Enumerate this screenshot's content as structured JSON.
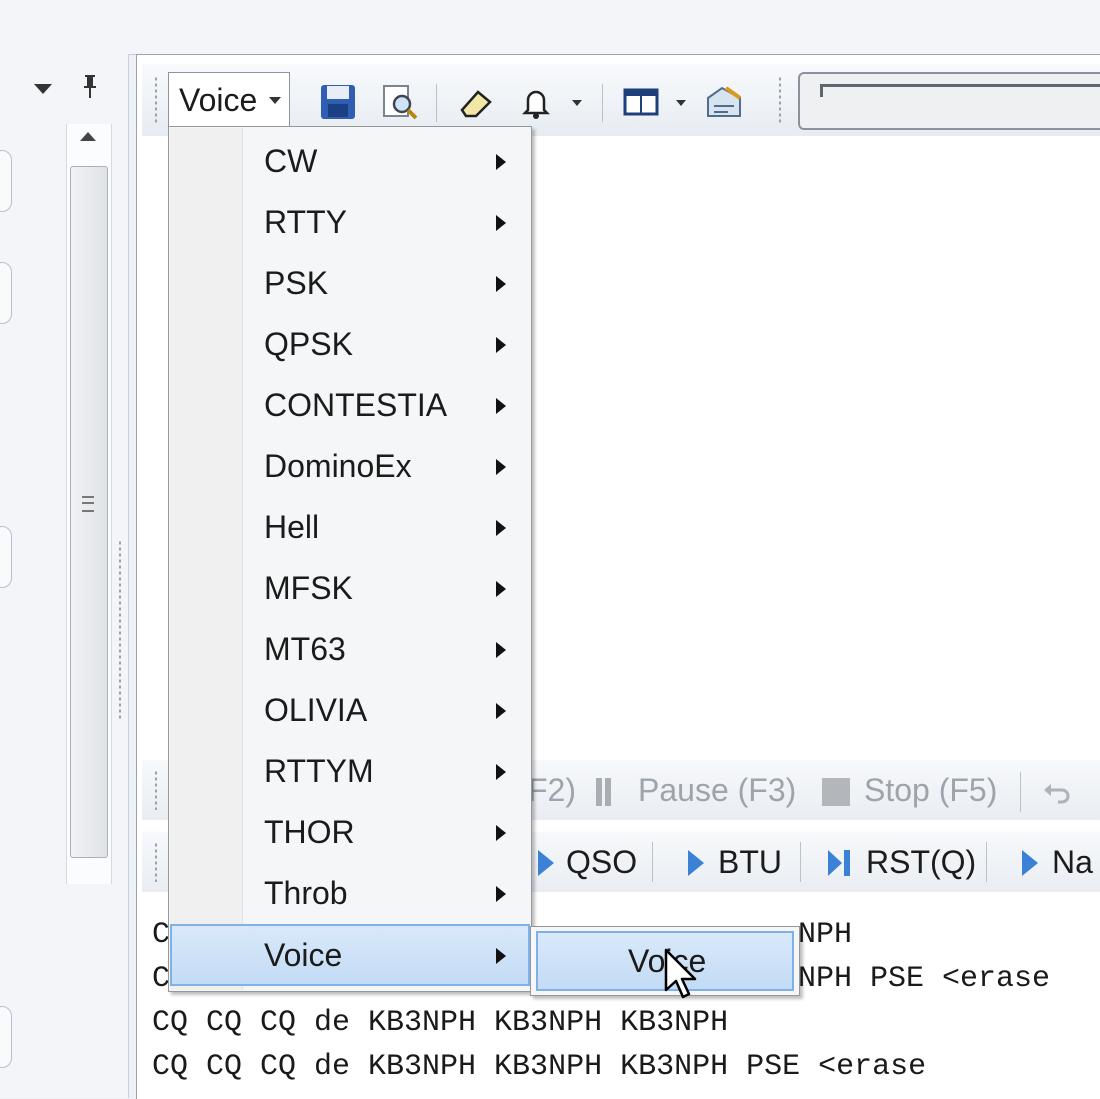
{
  "toolbar": {
    "mode_selected": "Voice",
    "icons": [
      "save-icon",
      "print-preview-icon",
      "eraser-icon",
      "bell-icon",
      "window-layout-icon",
      "settings-icon"
    ]
  },
  "mode_menu": {
    "items": [
      {
        "label": "CW"
      },
      {
        "label": "RTTY"
      },
      {
        "label": "PSK"
      },
      {
        "label": "QPSK"
      },
      {
        "label": "CONTESTIA"
      },
      {
        "label": "DominoEx"
      },
      {
        "label": "Hell"
      },
      {
        "label": "MFSK"
      },
      {
        "label": "MT63"
      },
      {
        "label": "OLIVIA"
      },
      {
        "label": "RTTYM"
      },
      {
        "label": "THOR"
      },
      {
        "label": "Throb"
      },
      {
        "label": "Voice"
      }
    ],
    "highlighted": "Voice"
  },
  "submenu": {
    "item_label": "Voice"
  },
  "tx_controls": {
    "transmit_partial": "F2)",
    "pause": "Pause  (F3)",
    "stop": "Stop  (F5)"
  },
  "macros": {
    "qso": "QSO",
    "btu": "BTU",
    "rst": "RST(Q)",
    "name_partial": "Na"
  },
  "tx_lines": [
    {
      "visible": "C",
      "right": "NPH"
    },
    {
      "visible": "C",
      "right": "NPH PSE <erase"
    },
    {
      "text": "CQ CQ CQ de KB3NPH KB3NPH KB3NPH"
    },
    {
      "text": "CQ CQ CQ de KB3NPH KB3NPH KB3NPH PSE <erase"
    }
  ],
  "tilde_fragment": "~  ~  ~",
  "colors": {
    "accent": "#3b82d6",
    "highlight": "#c3dbf5"
  }
}
